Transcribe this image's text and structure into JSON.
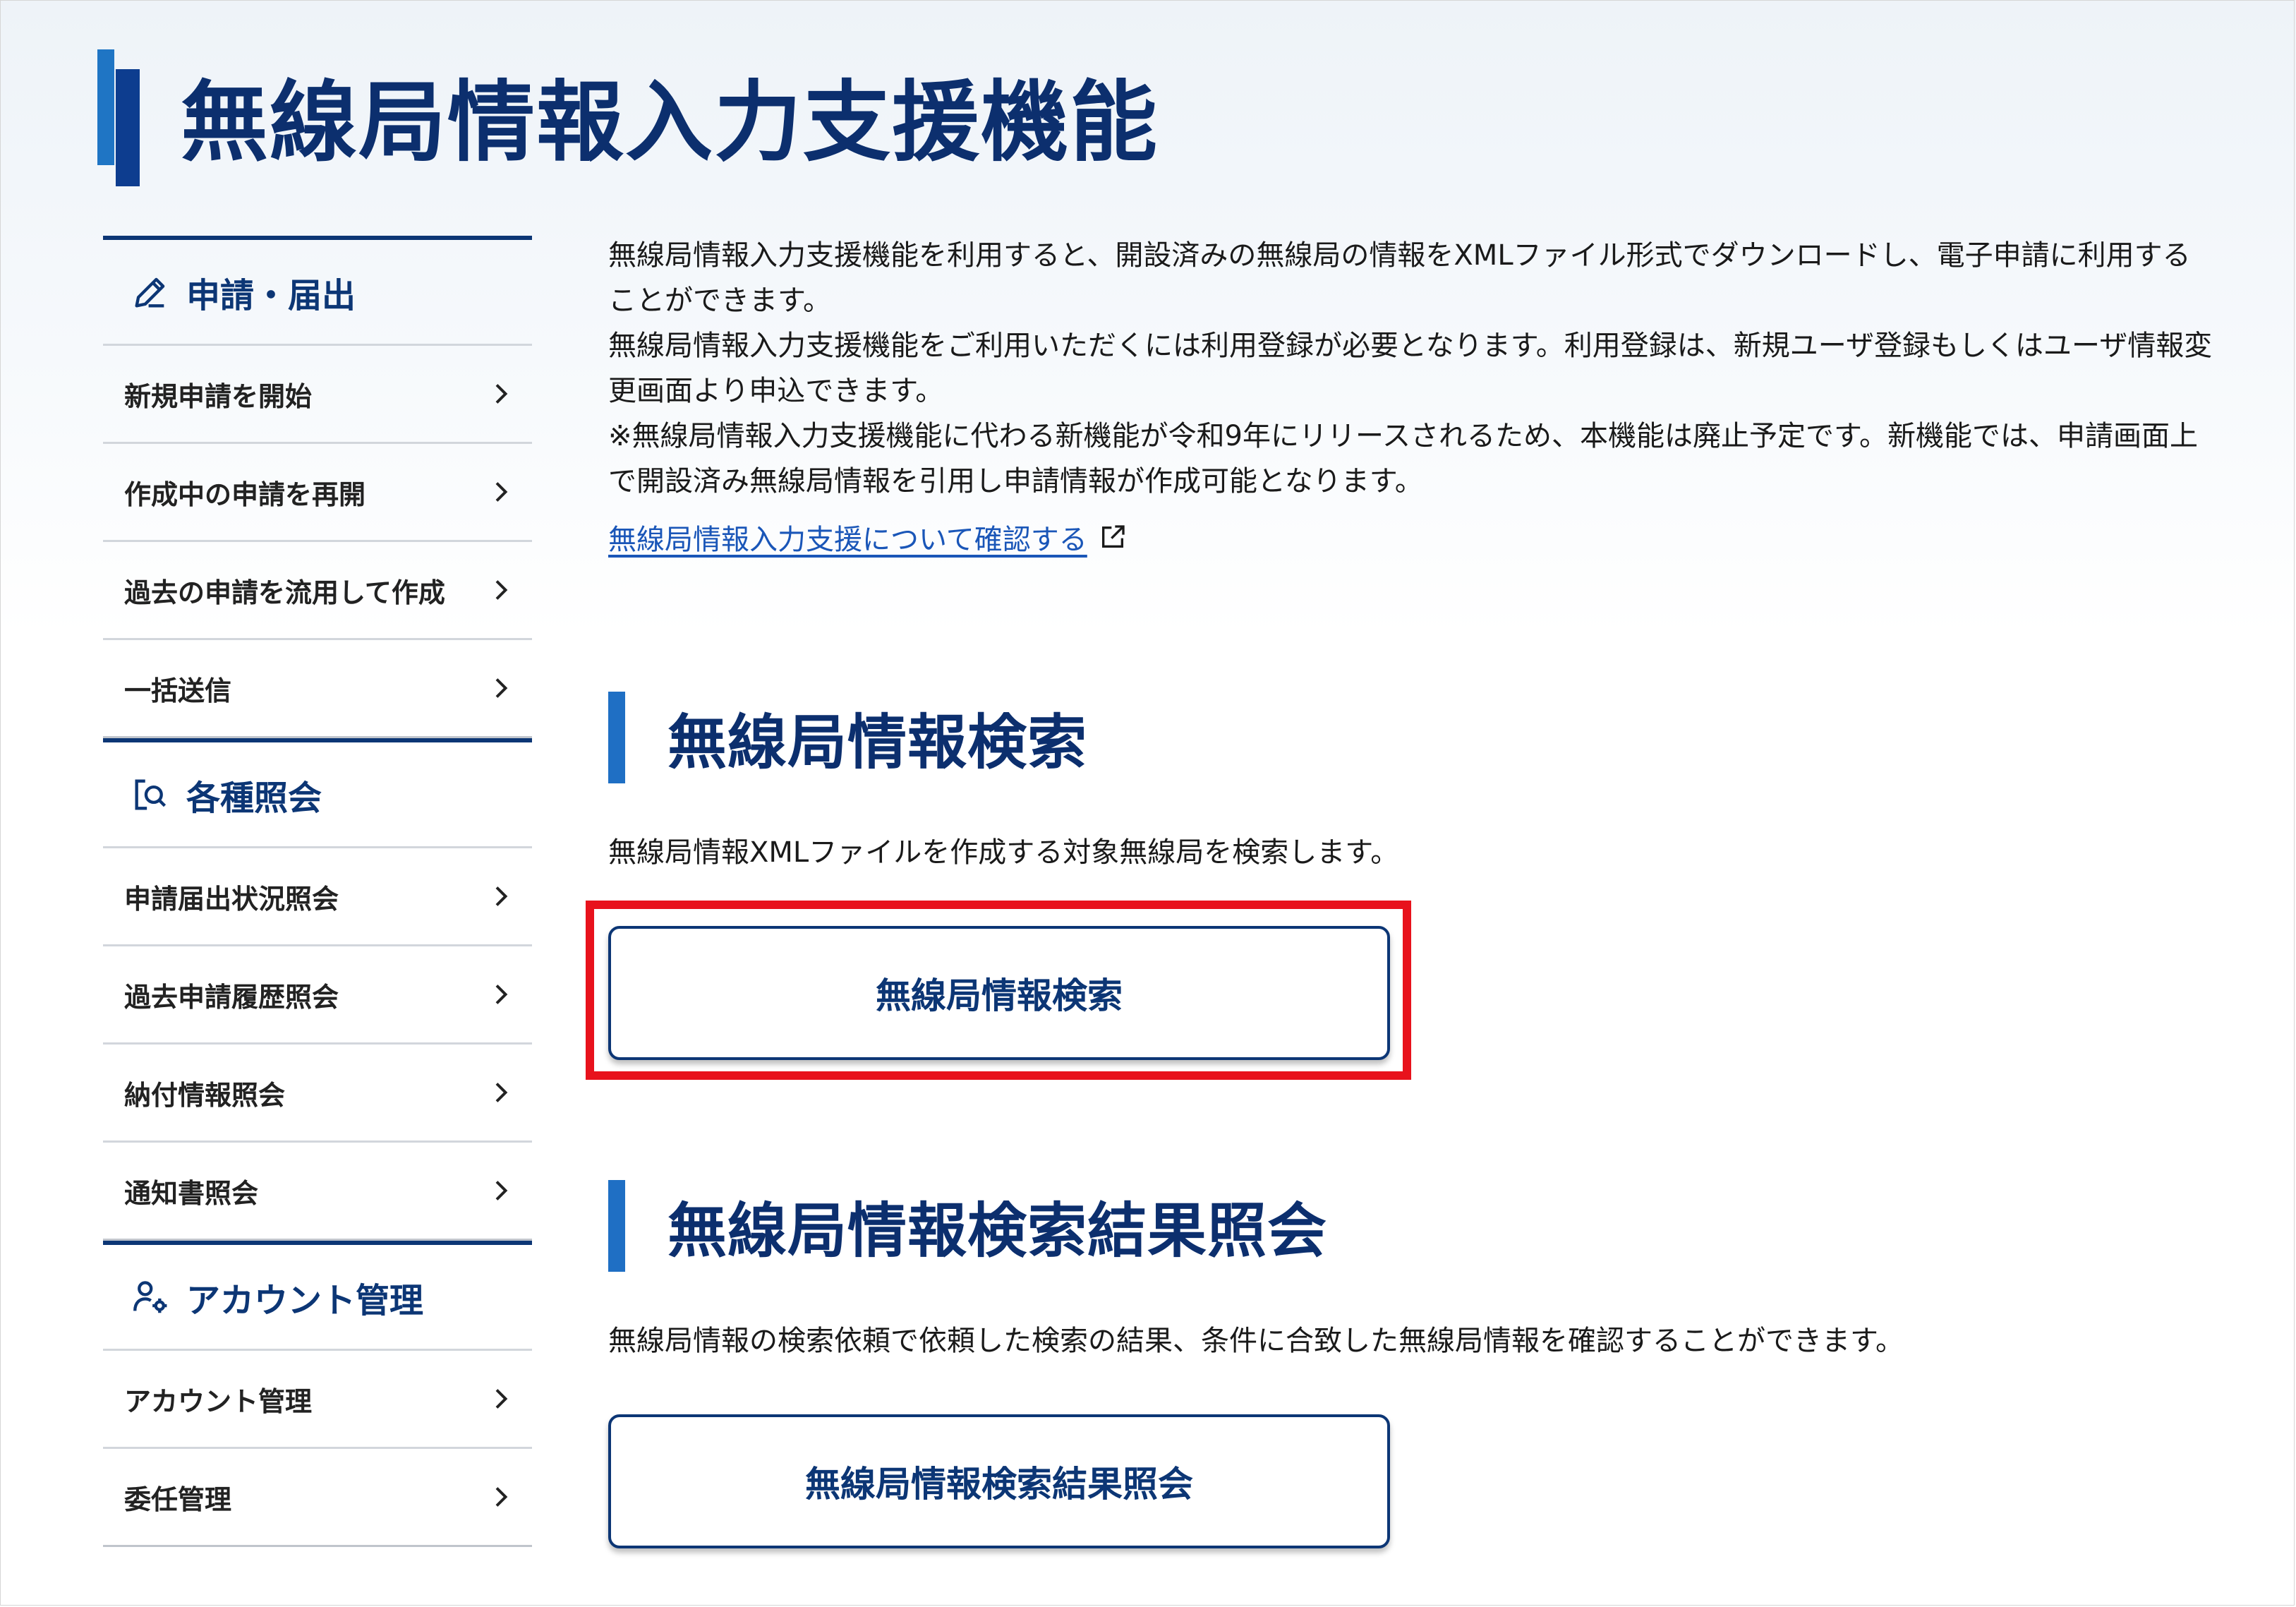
{
  "page": {
    "title": "無線局情報入力支援機能"
  },
  "sidebar": {
    "groups": [
      {
        "title": "申請・届出",
        "icon": "pencil-icon",
        "items": [
          {
            "label": "新規申請を開始"
          },
          {
            "label": "作成中の申請を再開"
          },
          {
            "label": "過去の申請を流用して作成"
          },
          {
            "label": "一括送信"
          }
        ]
      },
      {
        "title": "各種照会",
        "icon": "document-search-icon",
        "items": [
          {
            "label": "申請届出状況照会"
          },
          {
            "label": "過去申請履歴照会"
          },
          {
            "label": "納付情報照会"
          },
          {
            "label": "通知書照会"
          }
        ]
      },
      {
        "title": "アカウント管理",
        "icon": "user-settings-icon",
        "items": [
          {
            "label": "アカウント管理"
          },
          {
            "label": "委任管理"
          }
        ]
      }
    ]
  },
  "main": {
    "intro": {
      "lines": [
        "無線局情報入力支援機能を利用すると、開設済みの無線局の情報をXMLファイル形式でダウンロードし、電子申請に利用する",
        "ことができます。",
        "無線局情報入力支援機能をご利用いただくには利用登録が必要となります。利用登録は、新規ユーザ登録もしくはユーザ情報変",
        "更画面より申込できます。",
        "※無線局情報入力支援機能に代わる新機能が令和9年にリリースされるため、本機能は廃止予定です。新機能では、申請画面上",
        "で開設済み無線局情報を引用し申請情報が作成可能となります。"
      ],
      "link_label": "無線局情報入力支援について確認する"
    },
    "sections": [
      {
        "title": "無線局情報検索",
        "description": "無線局情報XMLファイルを作成する対象無線局を検索します。",
        "button_label": "無線局情報検索"
      },
      {
        "title": "無線局情報検索結果照会",
        "description": "無線局情報の検索依頼で依頼した検索の結果、条件に合致した無線局情報を確認することができます。",
        "button_label": "無線局情報検索結果照会"
      }
    ]
  },
  "colors": {
    "navy": "#0c3675",
    "accent_blue": "#1f6fc4",
    "link_blue": "#1a56b8",
    "highlight_red": "#e8121c"
  }
}
